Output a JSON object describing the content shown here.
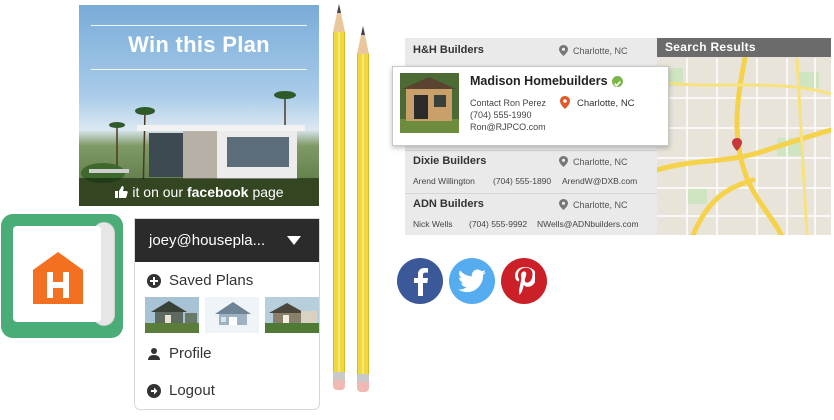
{
  "promo": {
    "title": "Win this Plan",
    "fb_prefix": "it on our",
    "fb_brand": "facebook",
    "fb_suffix": "page"
  },
  "account": {
    "email": "joey@housepla...",
    "menu": [
      {
        "label": "Saved Plans",
        "icon": "plus-circle-icon"
      },
      {
        "label": "Profile",
        "icon": "user-icon"
      },
      {
        "label": "Logout",
        "icon": "arrow-right-circle-icon"
      }
    ]
  },
  "listing": {
    "map_title": "Search Results",
    "builders": [
      {
        "name": "H&H Builders",
        "city": "Charlotte, NC",
        "contact": "",
        "phone": "",
        "email": ""
      },
      {
        "name": "Dixie Builders",
        "city": "Charlotte, NC",
        "contact": "Arend Willington",
        "phone": "(704) 555-1890",
        "email": "ArendW@DXB.com"
      },
      {
        "name": "ADN Builders",
        "city": "Charlotte, NC",
        "contact": "Nick Wells",
        "phone": "(704) 555-9992",
        "email": "NWells@ADNbuilders.com"
      }
    ],
    "featured": {
      "name": "Madison Homebuilders",
      "city": "Charlotte, NC",
      "contact": "Contact Ron Perez",
      "phone": "(704) 555-1990",
      "email": "Ron@RJPCO.com"
    }
  },
  "social": [
    {
      "name": "facebook",
      "color": "#3b5998",
      "glyph": "f"
    },
    {
      "name": "twitter",
      "color": "#55acee",
      "glyph": ""
    },
    {
      "name": "pinterest",
      "color": "#cb2027",
      "glyph": ""
    }
  ],
  "colors": {
    "logo_green": "#4aac77",
    "logo_orange": "#f37021",
    "pencil_yellow": "#f1d740"
  }
}
